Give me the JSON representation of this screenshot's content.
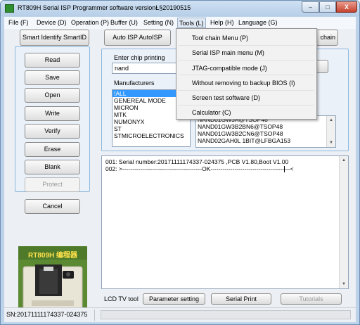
{
  "window": {
    "title": "RT809H Serial ISP Programmer software versionŁ§20190515",
    "min_glyph": "–",
    "max_glyph": "□",
    "close_glyph": "X"
  },
  "menubar": [
    "File (F)",
    "Device (D)",
    "Operation (P)",
    "Buffer (U)",
    "Setting (N)",
    "Tools (L)",
    "Help (H)",
    "Language (G)"
  ],
  "toolbar": {
    "smart_identify": "Smart Identify SmartID",
    "auto_isp": "Auto ISP AutoISP",
    "search_chain": "chain"
  },
  "actions": [
    "Read",
    "Save",
    "Open",
    "Write",
    "Verify",
    "Erase",
    "Blank",
    "Protect"
  ],
  "cancel_label": "Cancel",
  "chip_panel": {
    "enter_label": "Enter chip printing",
    "input_value": "nand",
    "manufacturers_label": "Manufacturers",
    "manufacturers": [
      "!ALL",
      "GENEREAL MODE",
      "MICRON",
      "MTK",
      "NUMONYX",
      "ST",
      "STMICROELECTRONICS"
    ],
    "chips": [
      "NAND01GW3A@TSOP48",
      "NAND01GW3B2BN6@TSOP48",
      "NAND01GW3B2CN6@TSOP48",
      "NAND02GAH0L 1BIT@LFBGA153"
    ]
  },
  "tools_menu": [
    "Tool chain Menu (P)",
    "Serial ISP main menu (M)",
    "JTAG-compatible mode (J)",
    "Without removing to backup BIOS (I)",
    "Screen test software (D)",
    "Calculator (C)"
  ],
  "log": {
    "line1": "001:  Serial number:20171111174337-024375  ,PCB V1.80,Boot V1.00",
    "line2": "002:  >----------------------------------------OK----------------------------------------<"
  },
  "bottom": {
    "lcd_label": "LCD TV tool",
    "parameter": "Parameter setting",
    "serial_print": "Serial Print",
    "tutorials": "Tutorials"
  },
  "device_image": {
    "label": "RT809H 编程器"
  },
  "status": {
    "sn": "SN:20171111174337-024375"
  },
  "colors": {
    "selection": "#3399ff",
    "device_green": "#4e7a2a",
    "close_red": "#c6422d"
  }
}
